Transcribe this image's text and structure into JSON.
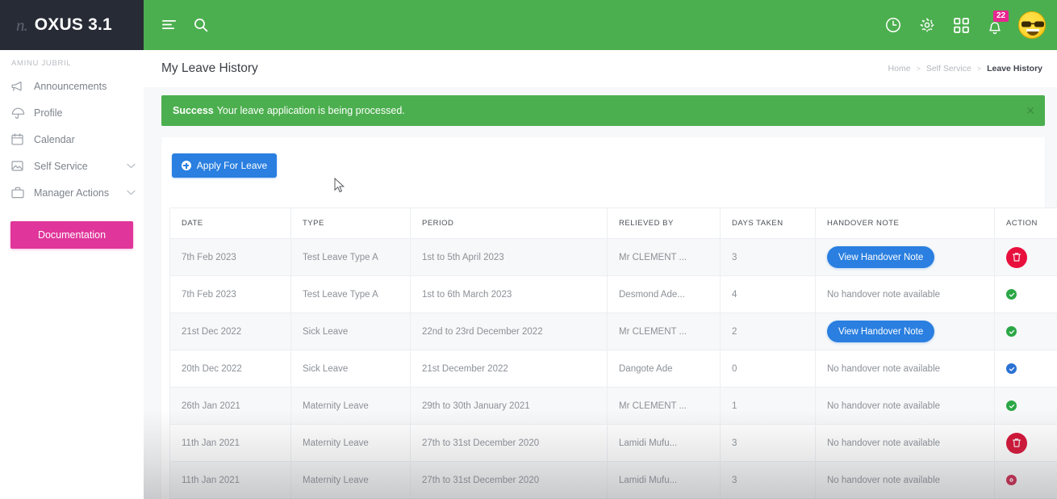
{
  "brand": {
    "logo_mark": "n.",
    "logo_text": "OXUS 3.1",
    "logo_bg": "#272b35"
  },
  "topbar": {
    "bg": "#4caf4f",
    "menu_icon": "hamburger-icon",
    "search_icon": "search-icon",
    "icons": [
      "clock-icon",
      "gear-icon",
      "grid-apps-icon",
      "bell-icon"
    ],
    "notification_count": "22",
    "badge_color": "#e8268f",
    "avatar_icon": "sunglasses-smiley-avatar"
  },
  "sidebar": {
    "user_label": "AMINU JUBRIL",
    "items": [
      {
        "label": "Announcements",
        "icon": "megaphone-icon",
        "has_chevron": false
      },
      {
        "label": "Profile",
        "icon": "umbrella-icon",
        "has_chevron": false
      },
      {
        "label": "Calendar",
        "icon": "calendar-icon",
        "has_chevron": false
      },
      {
        "label": "Self Service",
        "icon": "image-icon",
        "has_chevron": true
      },
      {
        "label": "Manager Actions",
        "icon": "briefcase-icon",
        "has_chevron": true
      }
    ],
    "documentation_label": "Documentation",
    "documentation_color": "#e0359a"
  },
  "page": {
    "title": "My Leave History",
    "breadcrumb": [
      {
        "label": "Home",
        "active": false
      },
      {
        "label": "Self Service",
        "active": false
      },
      {
        "label": "Leave History",
        "active": true
      }
    ],
    "breadcrumb_separator": ">"
  },
  "alert": {
    "strong": "Success",
    "message": "Your leave application is being processed.",
    "close_icon": "close-icon",
    "bg": "#4caf4f"
  },
  "toolbar": {
    "apply_label": "Apply For Leave",
    "apply_icon": "plus-circle-icon",
    "apply_color": "#2a7fe0"
  },
  "table": {
    "columns": [
      "DATE",
      "TYPE",
      "PERIOD",
      "RELIEVED BY",
      "DAYS TAKEN",
      "HANDOVER NOTE",
      "ACTION"
    ],
    "handover_button_label": "View Handover Note",
    "no_handover_label": "No handover note available",
    "rows": [
      {
        "date": "7th Feb 2023",
        "type": "Test Leave Type A",
        "period": "1st to 5th April 2023",
        "relieved_by": "Mr CLEMENT ...",
        "days_taken": "3",
        "handover": "View Handover Note",
        "has_handover": true,
        "action_icon": "delete-trash-icon",
        "action_style": "big-red",
        "action_color": "#e8103d"
      },
      {
        "date": "7th Feb 2023",
        "type": "Test Leave Type A",
        "period": "1st to 6th March 2023",
        "relieved_by": "Desmond Ade...",
        "days_taken": "4",
        "handover": "No handover note available",
        "has_handover": false,
        "action_icon": "check-circle-icon",
        "action_style": "small-green",
        "action_color": "#2aa745"
      },
      {
        "date": "21st Dec 2022",
        "type": "Sick Leave",
        "period": "22nd to 23rd December 2022",
        "relieved_by": "Mr CLEMENT ...",
        "days_taken": "2",
        "handover": "View Handover Note",
        "has_handover": true,
        "action_icon": "check-circle-icon",
        "action_style": "small-green",
        "action_color": "#2aa745"
      },
      {
        "date": "20th Dec 2022",
        "type": "Sick Leave",
        "period": "21st December 2022",
        "relieved_by": "Dangote Ade",
        "days_taken": "0",
        "handover": "No handover note available",
        "has_handover": false,
        "action_icon": "check-circle-icon",
        "action_style": "small-blue",
        "action_color": "#2a72d4"
      },
      {
        "date": "26th Jan 2021",
        "type": "Maternity Leave",
        "period": "29th to 30th January 2021",
        "relieved_by": "Mr CLEMENT ...",
        "days_taken": "1",
        "handover": "No handover note available",
        "has_handover": false,
        "action_icon": "check-circle-icon",
        "action_style": "small-green",
        "action_color": "#2aa745"
      },
      {
        "date": "11th Jan 2021",
        "type": "Maternity Leave",
        "period": "27th to 31st December 2020",
        "relieved_by": "Lamidi Mufu...",
        "days_taken": "3",
        "handover": "No handover note available",
        "has_handover": false,
        "action_icon": "delete-trash-icon",
        "action_style": "big-red",
        "action_color": "#d50f33"
      },
      {
        "date": "11th Jan 2021",
        "type": "Maternity Leave",
        "period": "27th to 31st December 2020",
        "relieved_by": "Lamidi Mufu...",
        "days_taken": "3",
        "handover": "No handover note available",
        "has_handover": false,
        "action_icon": "cancel-circle-icon",
        "action_style": "small-red",
        "action_color": "#c9234b"
      }
    ]
  }
}
